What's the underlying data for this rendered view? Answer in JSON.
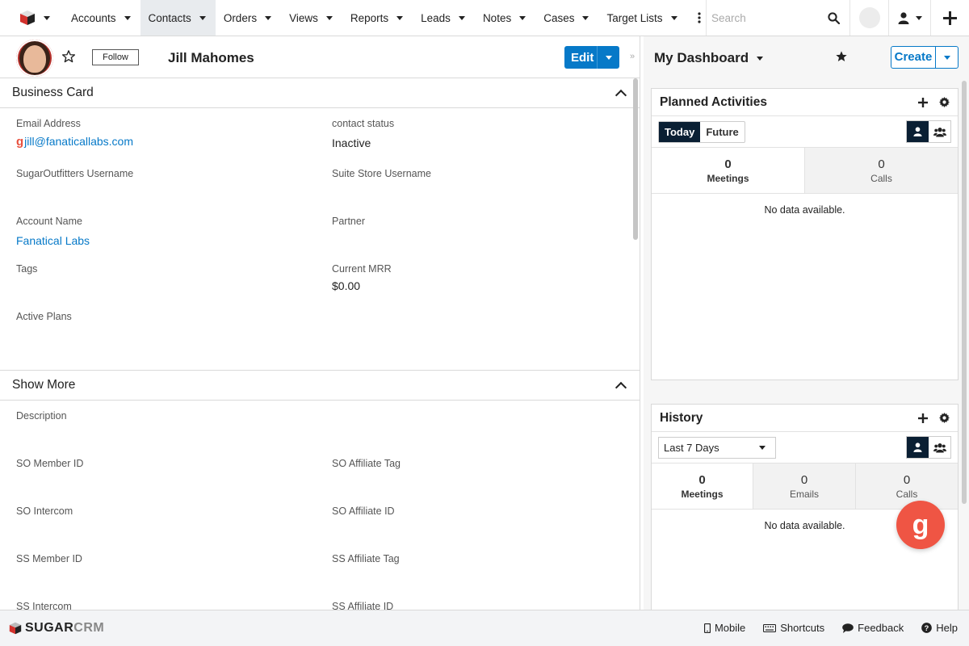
{
  "nav": {
    "items": [
      {
        "label": "Accounts"
      },
      {
        "label": "Contacts"
      },
      {
        "label": "Orders"
      },
      {
        "label": "Views"
      },
      {
        "label": "Reports"
      },
      {
        "label": "Leads"
      },
      {
        "label": "Notes"
      },
      {
        "label": "Cases"
      },
      {
        "label": "Target Lists"
      }
    ],
    "active": "Contacts",
    "search_placeholder": "Search"
  },
  "record": {
    "follow_label": "Follow",
    "name": "Jill Mahomes",
    "edit_label": "Edit"
  },
  "business_card": {
    "title": "Business Card",
    "fields": {
      "email_label": "Email Address",
      "email_value": "jill@fanaticallabs.com",
      "contact_status_label": "contact status",
      "contact_status_value": "Inactive",
      "so_username_label": "SugarOutfitters Username",
      "suite_store_label": "Suite Store Username",
      "account_name_label": "Account Name",
      "account_name_value": "Fanatical Labs",
      "partner_label": "Partner",
      "tags_label": "Tags",
      "current_mrr_label": "Current MRR",
      "current_mrr_value": "$0.00",
      "active_plans_label": "Active Plans"
    }
  },
  "show_more": {
    "title": "Show More",
    "fields": {
      "description_label": "Description",
      "so_member_id_label": "SO Member ID",
      "so_affiliate_tag_label": "SO Affiliate Tag",
      "so_intercom_label": "SO Intercom",
      "so_affiliate_id_label": "SO Affiliate ID",
      "ss_member_id_label": "SS Member ID",
      "ss_affiliate_tag_label": "SS Affiliate Tag",
      "ss_intercom_label": "SS Intercom",
      "ss_affiliate_id_label": "SS Affiliate ID"
    }
  },
  "dashboard": {
    "title": "My Dashboard",
    "create_label": "Create",
    "planned": {
      "title": "Planned Activities",
      "tab_today": "Today",
      "tab_future": "Future",
      "meetings_count": "0",
      "meetings_label": "Meetings",
      "calls_count": "0",
      "calls_label": "Calls",
      "empty": "No data available."
    },
    "history": {
      "title": "History",
      "range": "Last 7 Days",
      "meetings_count": "0",
      "meetings_label": "Meetings",
      "emails_count": "0",
      "emails_label": "Emails",
      "calls_count": "0",
      "calls_label": "Calls",
      "empty": "No data available."
    }
  },
  "footer": {
    "brand_a": "SUGAR",
    "brand_b": "CRM",
    "mobile": "Mobile",
    "shortcuts": "Shortcuts",
    "feedback": "Feedback",
    "help": "Help"
  },
  "colors": {
    "link": "#0679c8",
    "primary_button": "#0679c8",
    "toggle_dark": "#0a1f33",
    "fab": "#ef5544"
  },
  "icons": [
    "sugar-cube-icon",
    "kebab-icon",
    "search-icon",
    "user-icon",
    "plus-icon",
    "star-outline-icon",
    "star-icon",
    "chevron-up-icon",
    "gear-icon",
    "users-icon",
    "mobile-icon",
    "keyboard-icon",
    "comment-icon",
    "help-icon",
    "gravity-g-icon"
  ]
}
